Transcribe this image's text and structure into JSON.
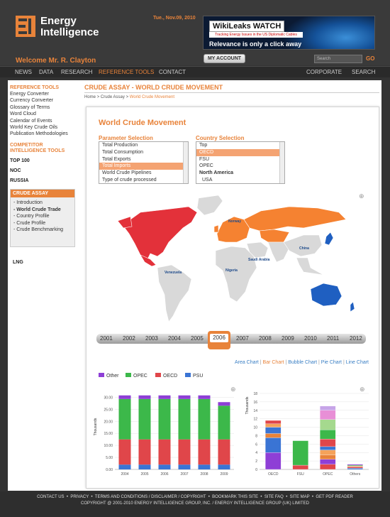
{
  "header": {
    "logo_line1": "Energy",
    "logo_line2": "Intelligence",
    "date": "Tue., Nov.09, 2010",
    "banner": {
      "title": "WikiLeaks WATCH",
      "subtitle": "Tracking Energy Issues in the US Diplomatic Cables",
      "tagline": "Relevance is only a click away"
    },
    "welcome": "Welcome Mr. R. Clayton",
    "my_account": "MY ACCOUNT",
    "search_placeholder": "Search",
    "go": "GO"
  },
  "nav": {
    "items": [
      "NEWS",
      "DATA",
      "RESEARCH",
      "REFERENCE TOOLS",
      "CONTACT"
    ],
    "active": "REFERENCE TOOLS",
    "right": [
      "CORPORATE",
      "SEARCH"
    ]
  },
  "sidebar": {
    "reference_title": "REFERENCE TOOLS",
    "reference_items": [
      "Energy Converter",
      "Currency Converter",
      "Glossary of Terms",
      "Word Cloud",
      "Calendar of Events",
      "World Key Crude Oils",
      "Publication Methodologies"
    ],
    "competitor_title1": "COMPETITOR",
    "competitor_title2": "INTELLIGENCE TOOLS",
    "competitor_items": [
      "TOP 100",
      "NOC",
      "RUSSIA"
    ],
    "crude_title": "CRUDE ASSAY",
    "crude_items": [
      "- Introduction",
      "- World Crude Trade",
      "- Country Profile",
      "- Crude Profile",
      "- Crude Benchmarking"
    ],
    "lng": "LNG"
  },
  "main": {
    "title": "CRUDE ASSAY - WORLD CRUDE MOVEMENT",
    "breadcrumb": {
      "home": "Home",
      "sep1": ">",
      "parent": "Crude Assay",
      "sep2": ">",
      "current": "World Crude Movement"
    },
    "panel_title": "World Crude Movement",
    "parameter_label": "Parameter Selection",
    "parameter_options": [
      "Total Production",
      "Total Consumption",
      "Total Exports",
      "Total Imports",
      "World Crude Pipelines",
      "Type of crude processed"
    ],
    "parameter_selected": "Total Imports",
    "country_label": "Country Selection",
    "country_options": [
      "Top",
      "OECD",
      "FSU",
      "OPEC",
      "North America",
      "USA"
    ],
    "country_selected": "OECD",
    "map_labels": [
      "Norway",
      "China",
      "Saudi Arabia",
      "Nigeria",
      "Venezuela"
    ],
    "years": [
      "2001",
      "2002",
      "2003",
      "2004",
      "2005",
      "2006",
      "2007",
      "2008",
      "2009",
      "2010",
      "2011",
      "2012"
    ],
    "selected_year": "2006",
    "chart_links": [
      "Area Chart",
      "Bar Chart",
      "Bubble Chart",
      "Pie Chart",
      "Line Chart"
    ],
    "active_chart_link": "Bar Chart"
  },
  "colors": {
    "accent": "#e8833a",
    "Other": "#8e3fd6",
    "OPEC": "#3cb84a",
    "OECD": "#e0464a",
    "FSU": "#3a74d4",
    "map_red": "#e3313a",
    "map_orange": "#f58231",
    "map_blue": "#1f5fc1",
    "map_grey": "#d9d9d9"
  },
  "chart_data": [
    {
      "type": "bar",
      "stacked": true,
      "categories": [
        "2004",
        "2005",
        "2006",
        "2007",
        "2008",
        "2009"
      ],
      "ylabel": "Thousands",
      "yticks": [
        "0.00",
        "5.00",
        "10.00",
        "15.00",
        "20.00",
        "25.00",
        "30.00"
      ],
      "ylim": [
        0,
        32.5
      ],
      "series": [
        {
          "name": "PSU",
          "values": [
            2.0,
            2.0,
            2.0,
            2.0,
            2.0,
            2.0
          ]
        },
        {
          "name": "OECD",
          "values": [
            10.5,
            10.5,
            10.5,
            10.5,
            10.5,
            10.5
          ]
        },
        {
          "name": "OPEC",
          "values": [
            16.8,
            16.8,
            16.8,
            16.8,
            16.8,
            14.0
          ]
        },
        {
          "name": "Other",
          "values": [
            1.5,
            1.5,
            1.5,
            1.5,
            1.5,
            1.5
          ]
        }
      ]
    },
    {
      "type": "bar",
      "stacked": true,
      "categories": [
        "OECD",
        "FSU",
        "OPEC",
        "Others"
      ],
      "ylabel": "Thousands",
      "yticks": [
        "0",
        "2",
        "4",
        "6",
        "8",
        "10",
        "12",
        "14",
        "16",
        "18"
      ],
      "ylim": [
        0,
        18.5
      ],
      "segments": [
        [
          {
            "v": 4.0,
            "c": "#8e3fd6"
          },
          {
            "v": 3.5,
            "c": "#3a74d4"
          },
          {
            "v": 1.0,
            "c": "#e8833a"
          },
          {
            "v": 1.5,
            "c": "#3a74d4"
          },
          {
            "v": 0.8,
            "c": "#f5a25a"
          },
          {
            "v": 0.8,
            "c": "#e0464a"
          }
        ],
        [
          {
            "v": 1.0,
            "c": "#e0464a"
          },
          {
            "v": 5.8,
            "c": "#3cb84a"
          }
        ],
        [
          {
            "v": 1.2,
            "c": "#e0464a"
          },
          {
            "v": 1.2,
            "c": "#8e3fd6"
          },
          {
            "v": 1.0,
            "c": "#e8833a"
          },
          {
            "v": 1.2,
            "c": "#f5a25a"
          },
          {
            "v": 0.8,
            "c": "#3a74d4"
          },
          {
            "v": 1.8,
            "c": "#e0464a"
          },
          {
            "v": 2.2,
            "c": "#3cb84a"
          },
          {
            "v": 2.4,
            "c": "#a5d98e"
          },
          {
            "v": 2.2,
            "c": "#e88fd6"
          },
          {
            "v": 1.0,
            "c": "#c7a4e8"
          }
        ],
        [
          {
            "v": 0.3,
            "c": "#3a74d4"
          },
          {
            "v": 0.3,
            "c": "#e0464a"
          },
          {
            "v": 0.2,
            "c": "#f5a25a"
          },
          {
            "v": 0.2,
            "c": "#3cb84a"
          },
          {
            "v": 0.2,
            "c": "#8e3fd6"
          }
        ]
      ]
    }
  ],
  "footer": {
    "links": [
      "CONTACT US",
      "PRIVACY",
      "TERMS AND CONDITIONS / DISCLAIMER / COPYRIGHT",
      "BOOKMARK THIS SITE",
      "SITE FAQ",
      "SITE MAP",
      "GET PDF READER"
    ],
    "copyright": "COPYRIGHT @ 2001-2010 ENERGY INTELLIGENCE GROUP, INC. / ENERGY INTELLIGENCE GROUP (UK) LIMITED"
  }
}
